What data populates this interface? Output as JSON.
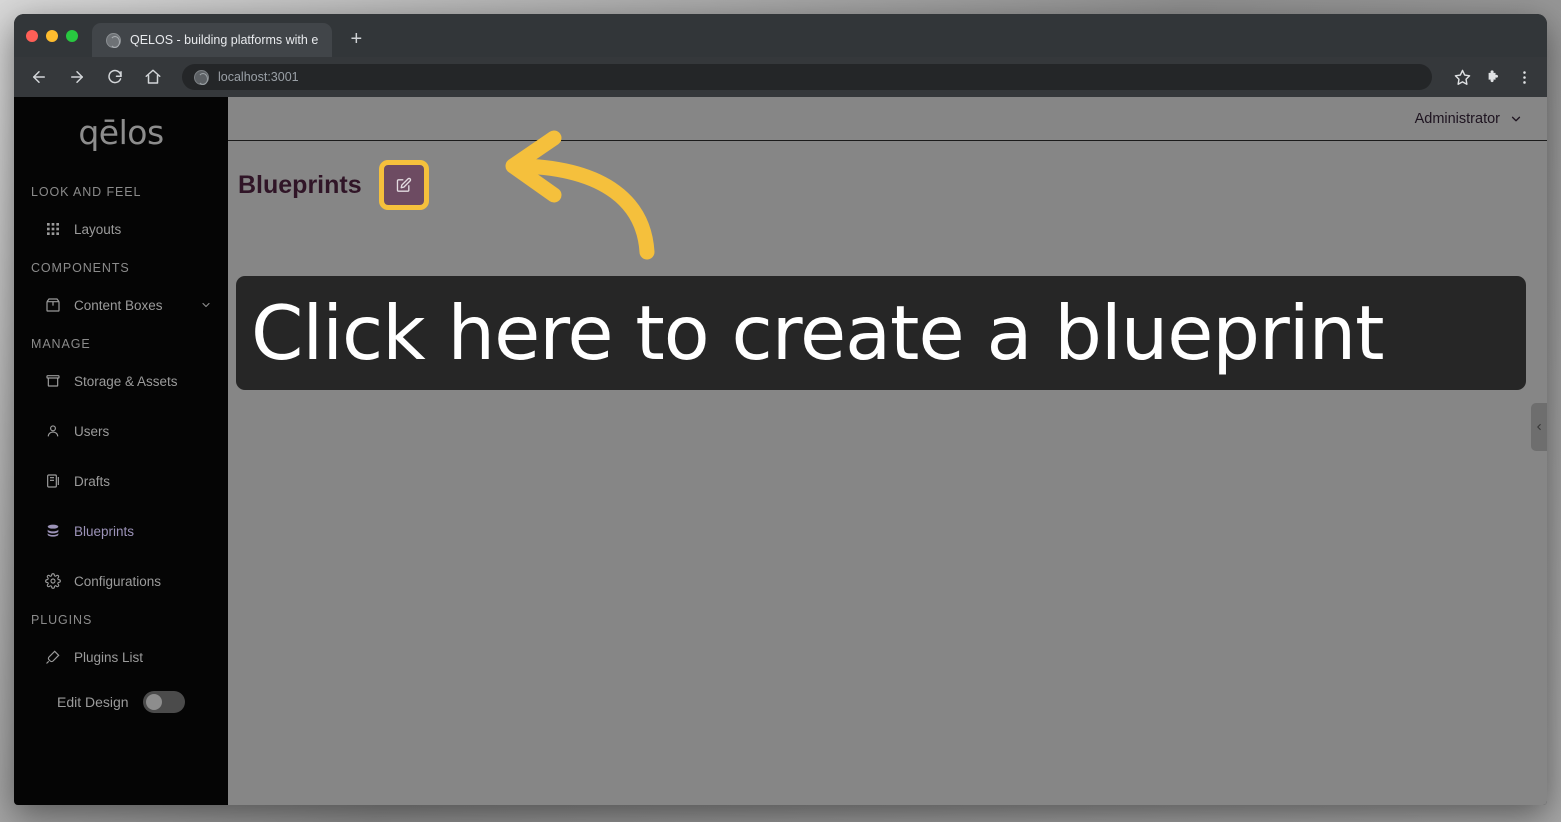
{
  "browser": {
    "tab": {
      "title": "QELOS - building platforms with e",
      "favicon_icon": "globe-icon"
    },
    "new_tab_label": "+",
    "nav": {
      "back_icon": "arrow-left-icon",
      "forward_icon": "arrow-right-icon",
      "reload_icon": "reload-icon",
      "home_icon": "home-icon"
    },
    "omnibox": {
      "value": "localhost:3001",
      "site_icon": "globe-icon"
    },
    "toolbar_right": {
      "bookmark_icon": "star-icon",
      "extensions_icon": "puzzle-piece-icon",
      "menu_icon": "three-dots-vertical-icon"
    }
  },
  "sidebar": {
    "logo": "qēlos",
    "sections": [
      {
        "title": "LOOK AND FEEL",
        "items": [
          {
            "label": "Layouts",
            "icon": "grid-icon",
            "active": false,
            "expandable": false
          }
        ]
      },
      {
        "title": "COMPONENTS",
        "items": [
          {
            "label": "Content Boxes",
            "icon": "box-icon",
            "active": false,
            "expandable": true
          }
        ]
      },
      {
        "title": "MANAGE",
        "items": [
          {
            "label": "Storage & Assets",
            "icon": "archive-icon",
            "active": false,
            "expandable": false
          },
          {
            "label": "Users",
            "icon": "user-icon",
            "active": false,
            "expandable": false
          },
          {
            "label": "Drafts",
            "icon": "copy-icon",
            "active": false,
            "expandable": false
          },
          {
            "label": "Blueprints",
            "icon": "database-icon",
            "active": true,
            "expandable": false
          },
          {
            "label": "Configurations",
            "icon": "gear-icon",
            "active": false,
            "expandable": false
          }
        ]
      },
      {
        "title": "PLUGINS",
        "items": [
          {
            "label": "Plugins List",
            "icon": "plug-icon",
            "active": false,
            "expandable": false
          }
        ]
      }
    ],
    "edit_design": {
      "label": "Edit Design",
      "enabled": false
    }
  },
  "topbar": {
    "user_label": "Administrator",
    "chevron_icon": "chevron-down-icon"
  },
  "page": {
    "title": "Blueprints",
    "create_button": {
      "icon": "edit-square-icon",
      "highlight_color": "#f5c03c",
      "background_color": "#6d4b62"
    }
  },
  "annotation": {
    "arrow_icon": "curved-arrow-left-icon",
    "arrow_color": "#f5c03c",
    "banner_text": "Click here to create a blueprint",
    "banner_background": "#262626"
  },
  "panel_handle": {
    "icon": "chevron-left-icon"
  },
  "colors": {
    "page_background": "#868686",
    "sidebar_background": "#050505",
    "title_color": "#301527",
    "active_nav_color": "#9c93b8"
  }
}
